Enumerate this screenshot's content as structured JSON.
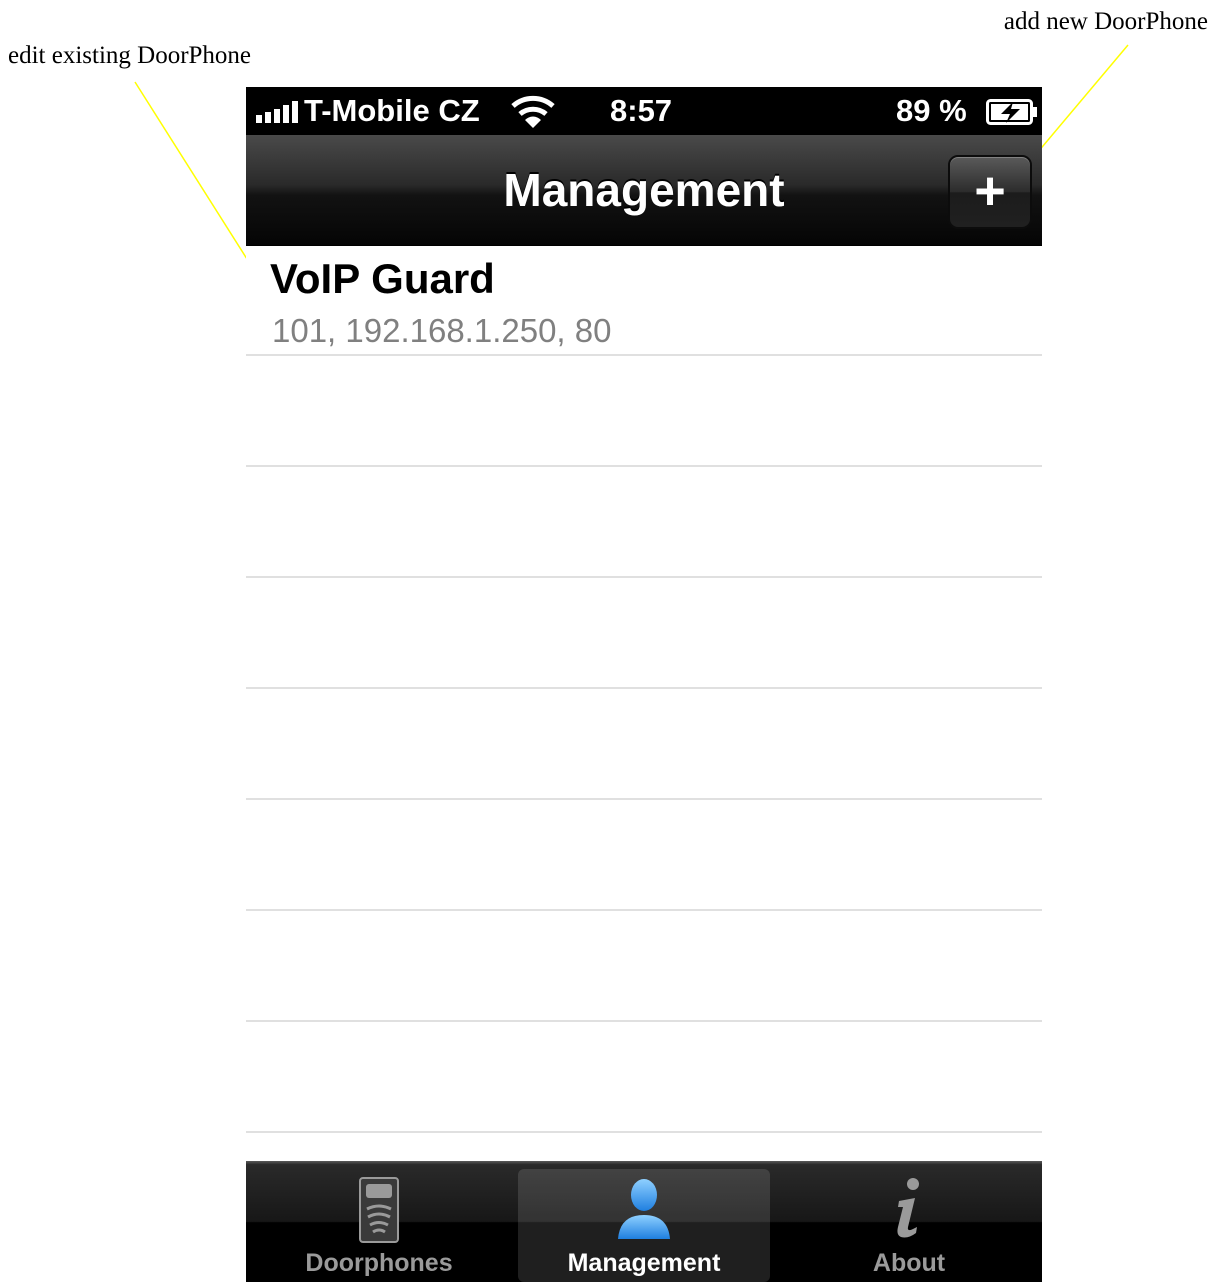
{
  "annotations": {
    "edit": "edit existing DoorPhone",
    "add": "add new DoorPhone"
  },
  "statusbar": {
    "carrier": "T-Mobile CZ",
    "time": "8:57",
    "battery": "89 %"
  },
  "navbar": {
    "title": "Management",
    "add_button": "+"
  },
  "list": {
    "items": [
      {
        "title": "VoIP Guard",
        "subtitle": "101, 192.168.1.250, 80"
      }
    ]
  },
  "tabbar": {
    "tabs": [
      {
        "label": "Doorphones",
        "icon": "doorphone-icon"
      },
      {
        "label": "Management",
        "icon": "person-icon",
        "active": true
      },
      {
        "label": "About",
        "icon": "info-icon"
      }
    ]
  },
  "colors": {
    "callout_line": "#ffff00",
    "active_icon": "#3aa0ff",
    "subtitle": "#808080"
  }
}
